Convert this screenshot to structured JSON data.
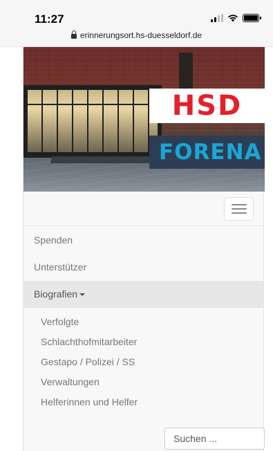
{
  "status_bar": {
    "time": "11:27",
    "url": "erinnerungsort.hs-duesseldorf.de",
    "icons": [
      "signal-icon",
      "wifi-icon",
      "battery-icon"
    ]
  },
  "header": {
    "logos": {
      "hsd": "HSD",
      "forena": "FORENA"
    },
    "colors": {
      "hsd_red": "#e4202b",
      "forena_bg": "#2d3e54",
      "forena_text": "#1aa6d6"
    }
  },
  "navbar": {
    "toggle_icon": "hamburger-menu-icon"
  },
  "menu": {
    "items": [
      {
        "label": "Spenden"
      },
      {
        "label": "Unterstützer"
      },
      {
        "label": "Biografien",
        "expanded": true
      }
    ],
    "submenu": [
      {
        "label": "Verfolgte"
      },
      {
        "label": "Schlachthofmitarbeiter"
      },
      {
        "label": "Gestapo / Polizei / SS"
      },
      {
        "label": "Verwaltungen"
      },
      {
        "label": "Helferinnen und Helfer"
      }
    ]
  },
  "search": {
    "placeholder": "Suchen ..."
  }
}
